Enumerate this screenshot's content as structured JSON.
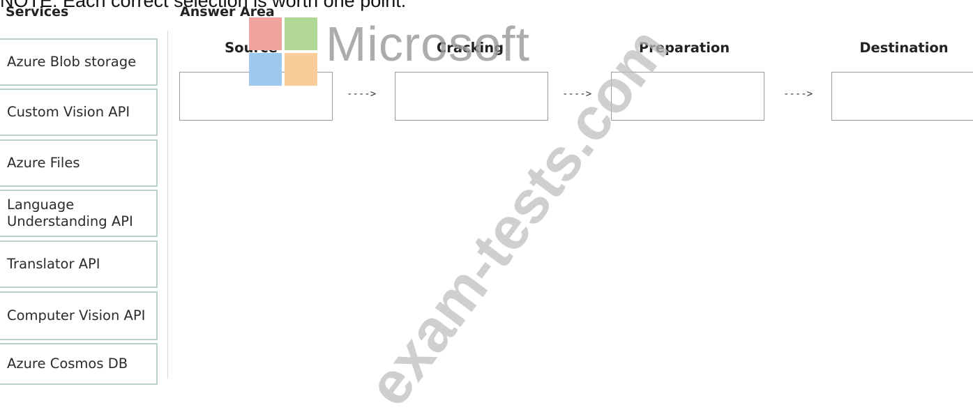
{
  "note": "NOTE: Each correct selection is worth one point.",
  "services": {
    "heading": "Services",
    "items": [
      {
        "label": "Azure Blob storage"
      },
      {
        "label": "Custom Vision API"
      },
      {
        "label": "Azure Files"
      },
      {
        "label": "Language Understanding API"
      },
      {
        "label": "Translator API"
      },
      {
        "label": "Computer Vision API"
      },
      {
        "label": "Azure Cosmos DB"
      }
    ]
  },
  "answer_area": {
    "heading": "Answer Area",
    "stages": [
      {
        "label": "Source"
      },
      {
        "label": "Cracking"
      },
      {
        "label": "Preparation"
      },
      {
        "label": "Destination"
      }
    ],
    "arrow": "---->"
  },
  "watermark": {
    "brand": "Microsoft",
    "site": "exam-tests.com",
    "logo_colors": [
      "#f0a39c",
      "#b0d794",
      "#9fc8ee",
      "#f8cd9a"
    ]
  }
}
